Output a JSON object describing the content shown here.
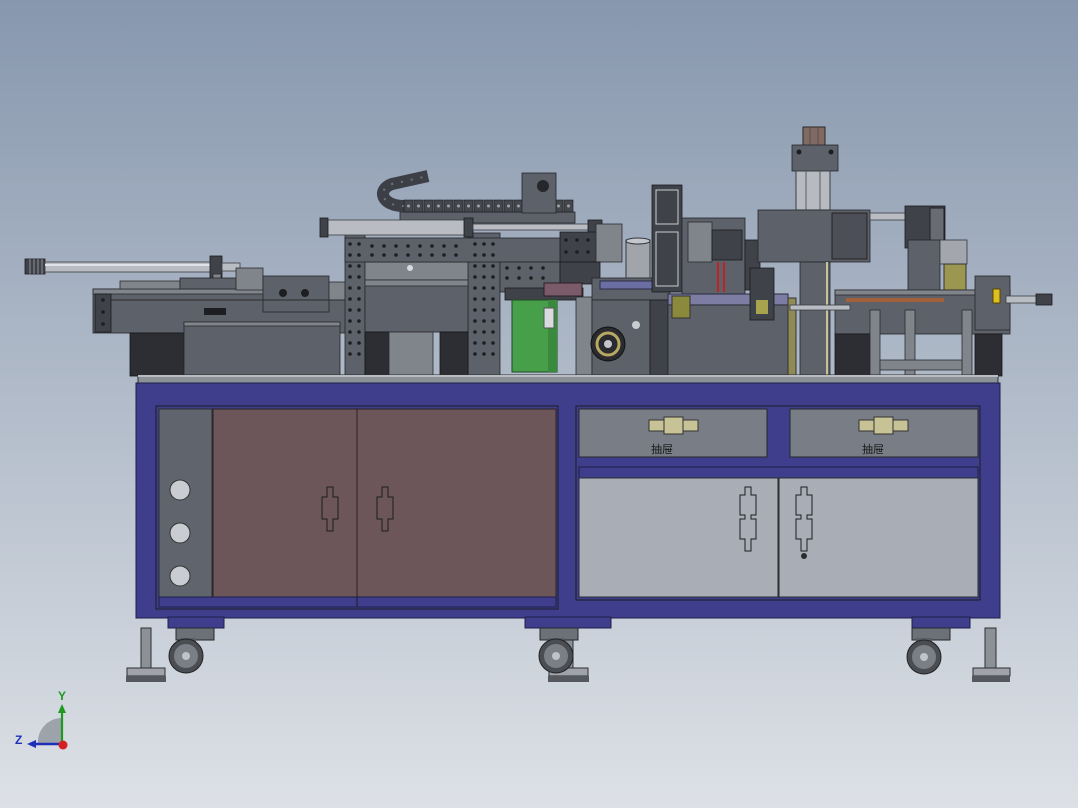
{
  "viewport": {
    "background": {
      "top": "#8797ae",
      "bottom": "#dde1e6"
    }
  },
  "model": {
    "colors": {
      "frame": "#3e3e8c",
      "door_brown": "#6d5659",
      "door_gray": "#a9adb5",
      "drawer": "#787d86",
      "handle": "#c8c397",
      "green_block": "#47a049",
      "copper_cap": "#7f6a64"
    },
    "cabinet": {
      "drawers": [
        {
          "label": "抽屉"
        },
        {
          "label": "抽屉"
        }
      ]
    }
  },
  "triad": {
    "icon": "coordinate-triad-icon",
    "axes": {
      "x": {
        "color": "#d42020"
      },
      "y": {
        "label": "Y",
        "color": "#1e9a1e"
      },
      "z": {
        "label": "Z",
        "color": "#1f2fb8"
      }
    }
  }
}
